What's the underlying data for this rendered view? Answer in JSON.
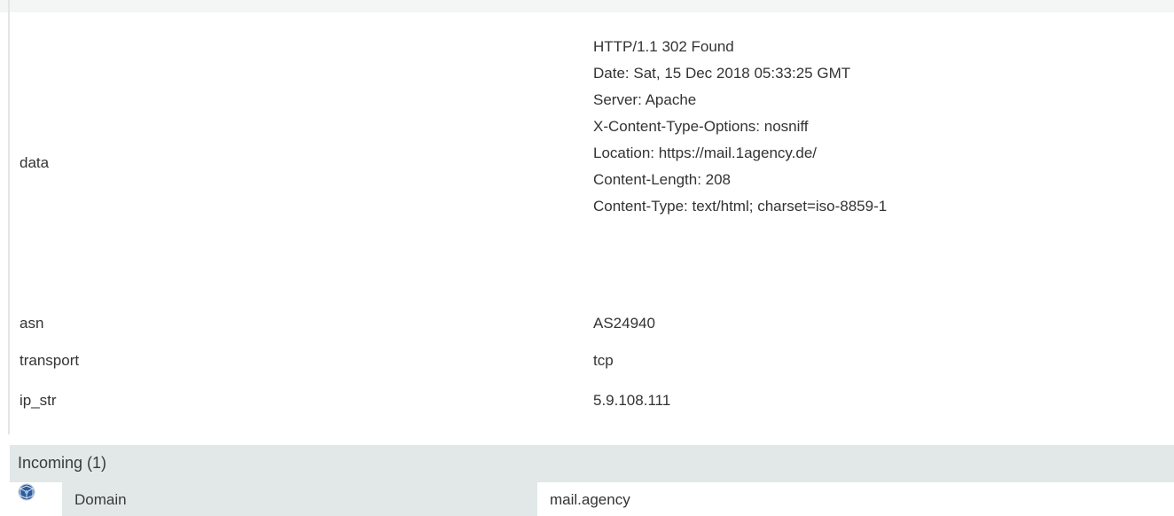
{
  "properties": {
    "data": {
      "key": "data",
      "lines": [
        "HTTP/1.1 302 Found",
        "Date: Sat, 15 Dec 2018 05:33:25 GMT",
        "Server: Apache",
        "X-Content-Type-Options: nosniff",
        "Location: https://mail.1agency.de/",
        "Content-Length: 208",
        "Content-Type: text/html; charset=iso-8859-1"
      ]
    },
    "asn": {
      "key": "asn",
      "value": "AS24940"
    },
    "transport": {
      "key": "transport",
      "value": "tcp"
    },
    "ip_str": {
      "key": "ip_str",
      "value": "5.9.108.111"
    }
  },
  "incoming": {
    "title": "Incoming (1)",
    "rows": [
      {
        "icon": "globe-icon",
        "type": "Domain",
        "value": "mail.agency"
      }
    ]
  },
  "colors": {
    "section_header_bg": "#e2e8e8",
    "icon_blue": "#2d5b9a"
  }
}
